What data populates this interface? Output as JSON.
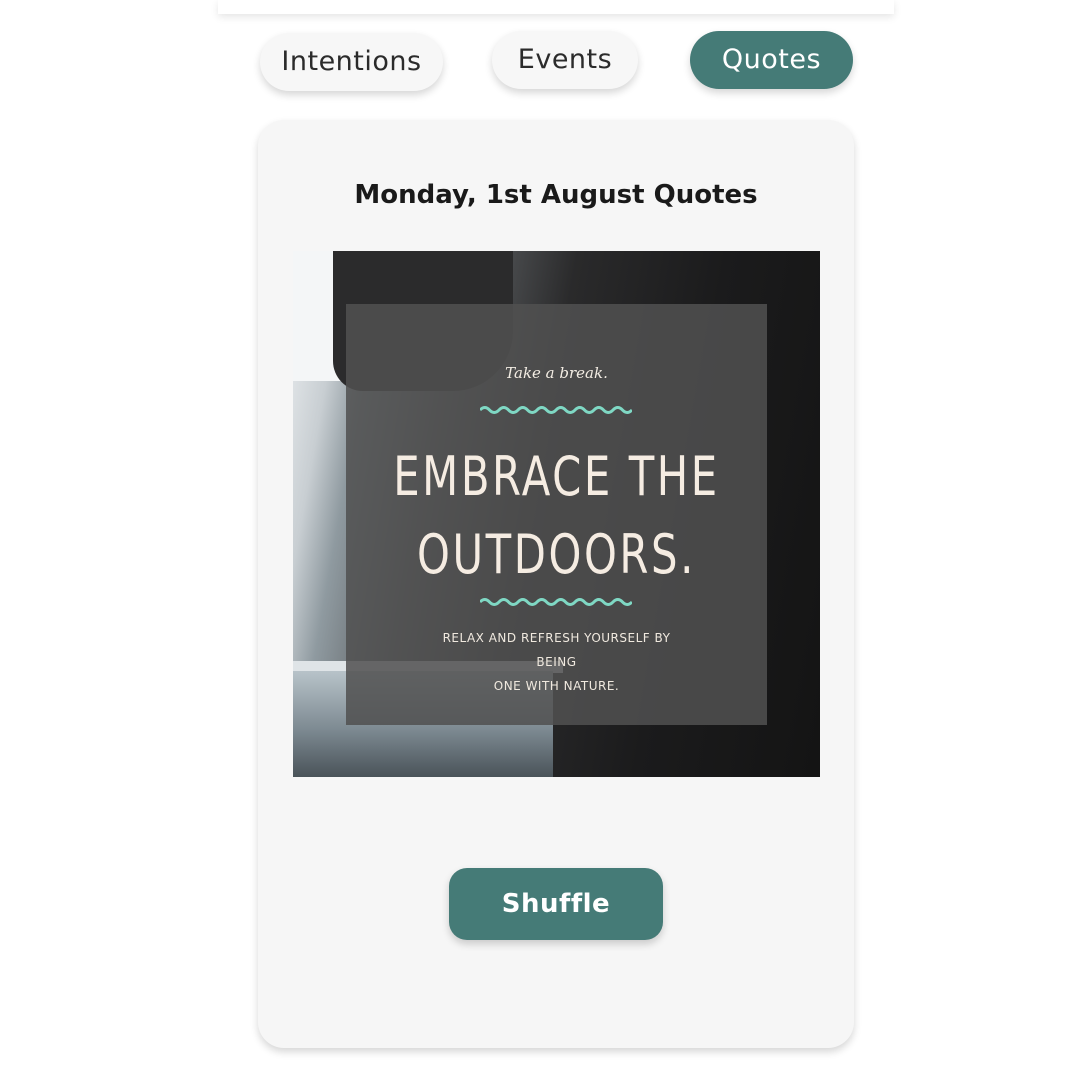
{
  "colors": {
    "accent": "#457b77",
    "wave": "#7fd8c4"
  },
  "tabs": [
    {
      "label": "Intentions",
      "active": false
    },
    {
      "label": "Events",
      "active": false
    },
    {
      "label": "Quotes",
      "active": true
    }
  ],
  "card": {
    "title": "Monday, 1st August Quotes"
  },
  "quote_image": {
    "tagline": "Take a break.",
    "headline_line1": "EMBRACE THE",
    "headline_line2": "OUTDOORS.",
    "subtext_line1": "RELAX AND REFRESH YOURSELF BY BEING",
    "subtext_line2": "ONE WITH NATURE."
  },
  "actions": {
    "shuffle_label": "Shuffle"
  }
}
